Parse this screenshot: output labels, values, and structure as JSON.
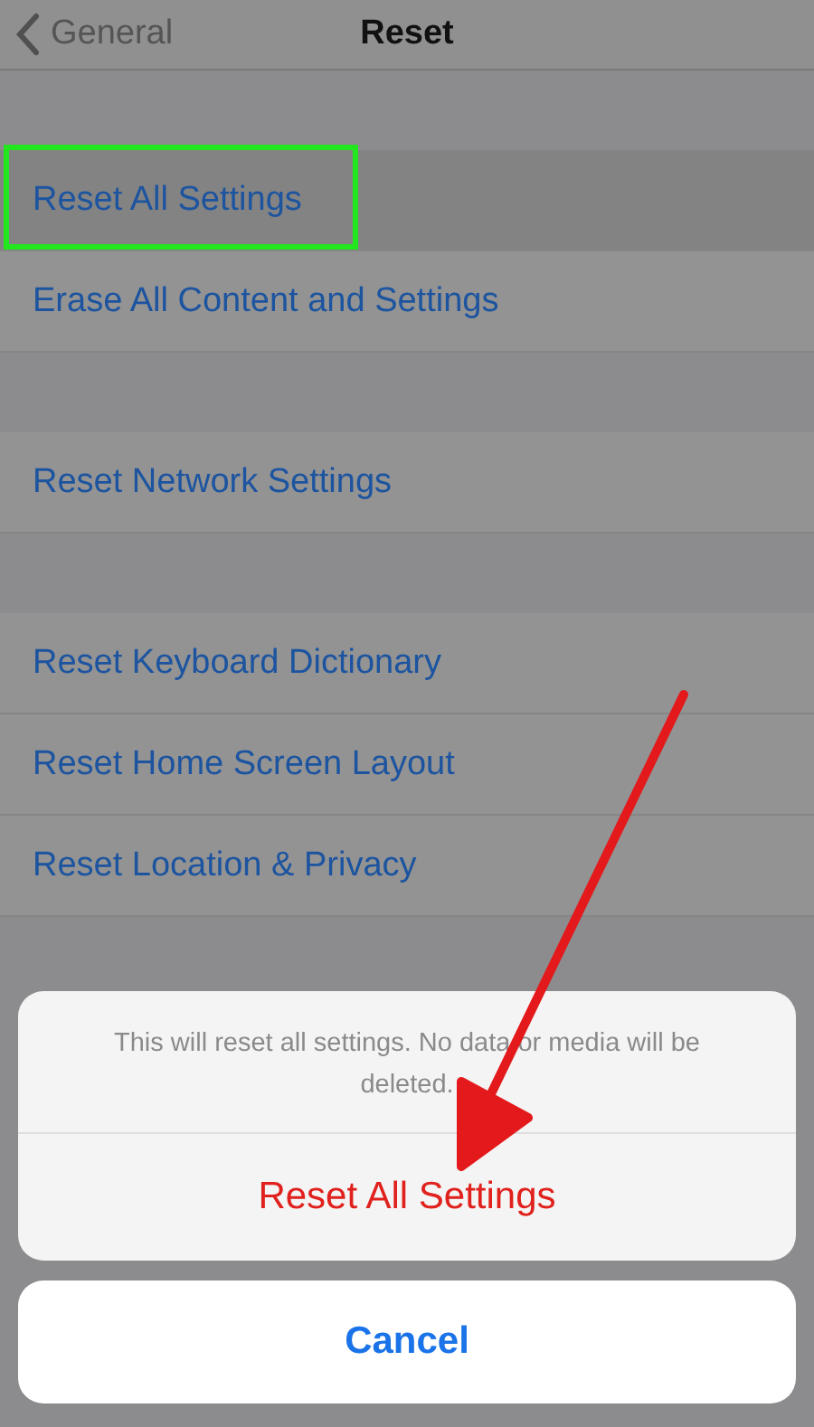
{
  "nav": {
    "back": "General",
    "title": "Reset"
  },
  "groups": [
    {
      "items": [
        {
          "label": "Reset All Settings",
          "selected": true,
          "highlighted": true
        },
        {
          "label": "Erase All Content and Settings",
          "selected": false,
          "highlighted": false
        }
      ]
    },
    {
      "items": [
        {
          "label": "Reset Network Settings",
          "selected": false,
          "highlighted": false
        }
      ]
    },
    {
      "items": [
        {
          "label": "Reset Keyboard Dictionary",
          "selected": false,
          "highlighted": false
        },
        {
          "label": "Reset Home Screen Layout",
          "selected": false,
          "highlighted": false
        },
        {
          "label": "Reset Location & Privacy",
          "selected": false,
          "highlighted": false
        }
      ]
    }
  ],
  "sheet": {
    "message": "This will reset all settings. No data or media will be deleted.",
    "actions": [
      {
        "label": "Reset All Settings",
        "kind": "destructive"
      }
    ],
    "cancel": "Cancel"
  },
  "annotation": {
    "arrow": true
  }
}
